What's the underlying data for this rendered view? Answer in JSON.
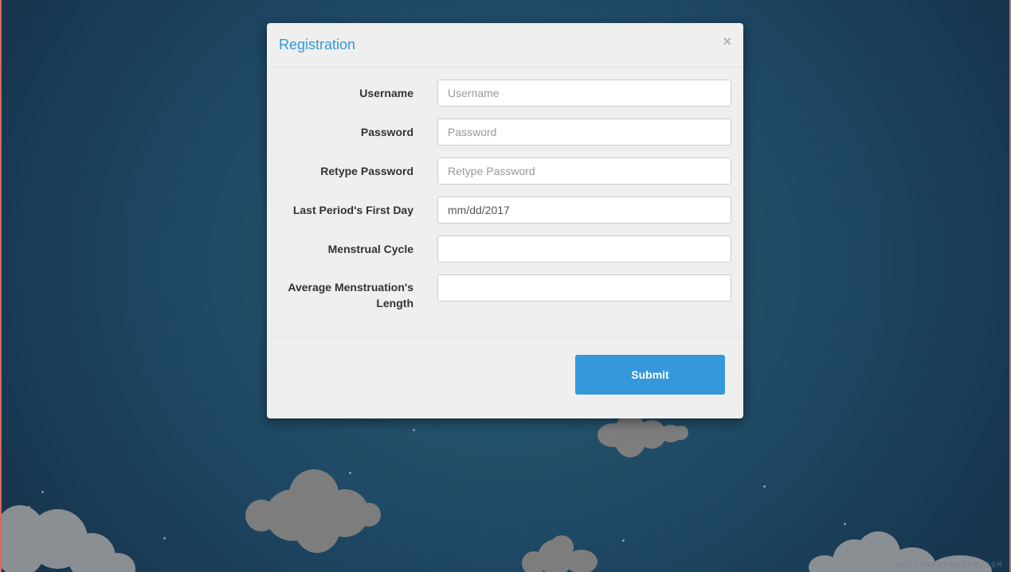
{
  "modal": {
    "title": "Registration",
    "close_symbol": "×",
    "fields": [
      {
        "label": "Username",
        "placeholder": "Username",
        "value": ""
      },
      {
        "label": "Password",
        "placeholder": "Password",
        "value": ""
      },
      {
        "label": "Retype Password",
        "placeholder": "Retype Password",
        "value": ""
      },
      {
        "label": "Last Period's First Day",
        "placeholder": "",
        "value": "mm/dd/2017"
      },
      {
        "label": "Menstrual Cycle",
        "placeholder": "",
        "value": ""
      },
      {
        "label": "Average Menstruation's Length",
        "placeholder": "",
        "value": ""
      }
    ],
    "submit_label": "Submit"
  },
  "watermark": "WALLPAPERSWIDE.COM",
  "colors": {
    "accent": "#3498db",
    "modal_bg": "#efefef",
    "background": "#1d4561",
    "edge": "#d9675e"
  }
}
